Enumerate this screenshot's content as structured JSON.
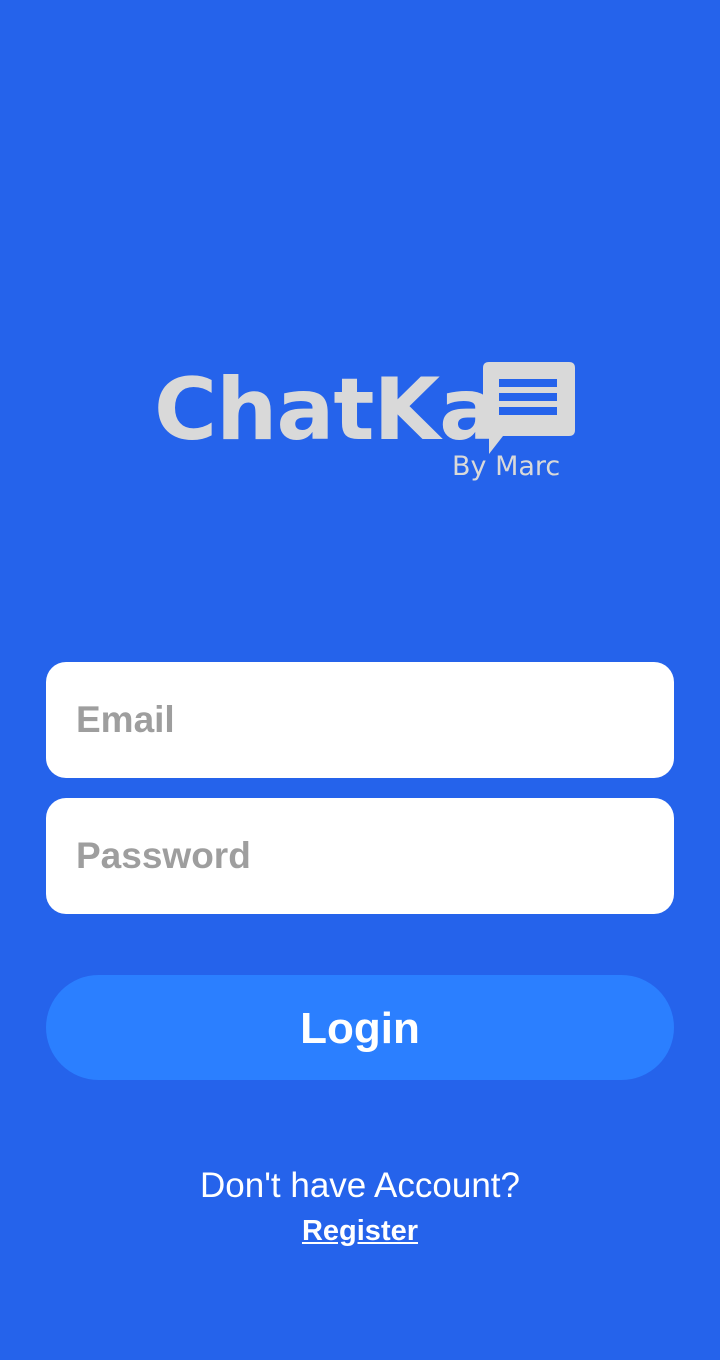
{
  "logo": {
    "wordmark": "ChatKa",
    "subtitle": "By Marc",
    "icon": "chat-bubble-icon",
    "color": "#D9D9D9"
  },
  "login_form": {
    "email": {
      "placeholder": "Email",
      "value": ""
    },
    "password": {
      "placeholder": "Password",
      "value": ""
    },
    "login_label": "Login"
  },
  "footer": {
    "prompt": "Don't have Account?",
    "register_label": "Register"
  },
  "colors": {
    "background": "#2563EB",
    "button": "#2B7FFF",
    "field": "#FFFFFF",
    "placeholder": "#9E9E9E"
  }
}
